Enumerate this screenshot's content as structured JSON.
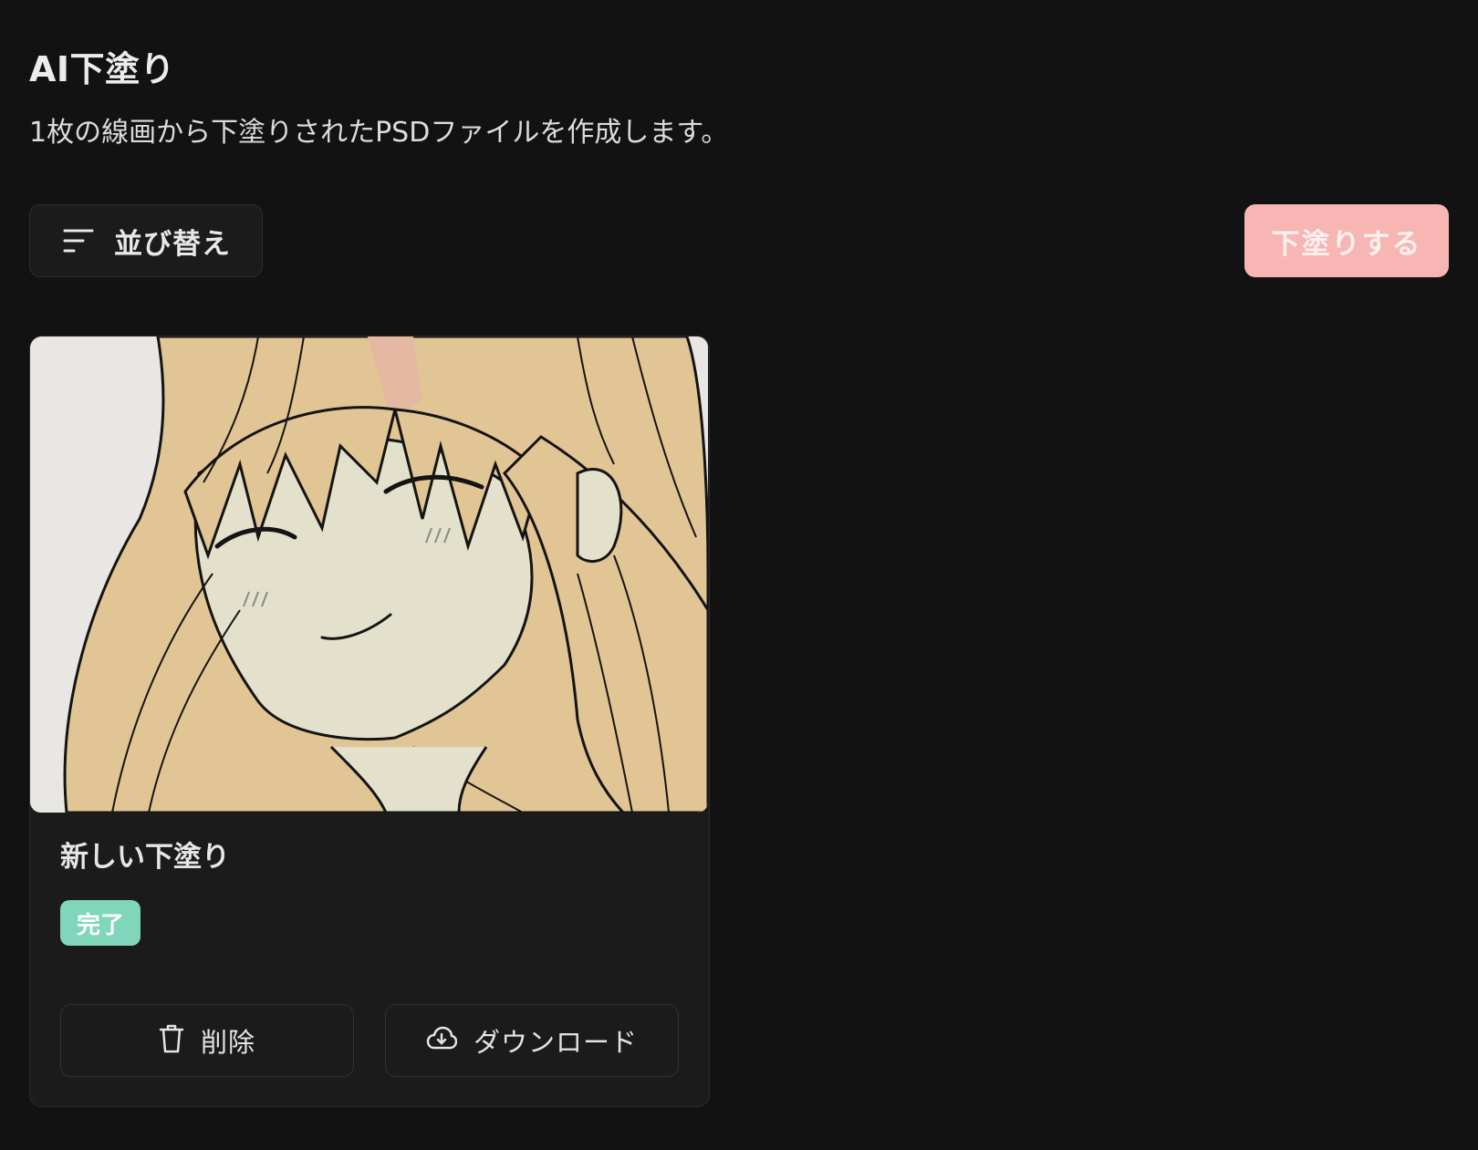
{
  "header": {
    "title": "AI下塗り",
    "description": "1枚の線画から下塗りされたPSDファイルを作成します。"
  },
  "toolbar": {
    "sort_label": "並び替え",
    "sort_icon": "sort-lines-icon",
    "primary_label": "下塗りする",
    "primary_color": "#f7b5b3"
  },
  "cards": [
    {
      "title": "新しい下塗り",
      "status": "完了",
      "status_color": "#7fd6bb",
      "delete_label": "削除",
      "delete_icon": "trash-icon",
      "download_label": "ダウンロード",
      "download_icon": "cloud-download-icon"
    }
  ]
}
